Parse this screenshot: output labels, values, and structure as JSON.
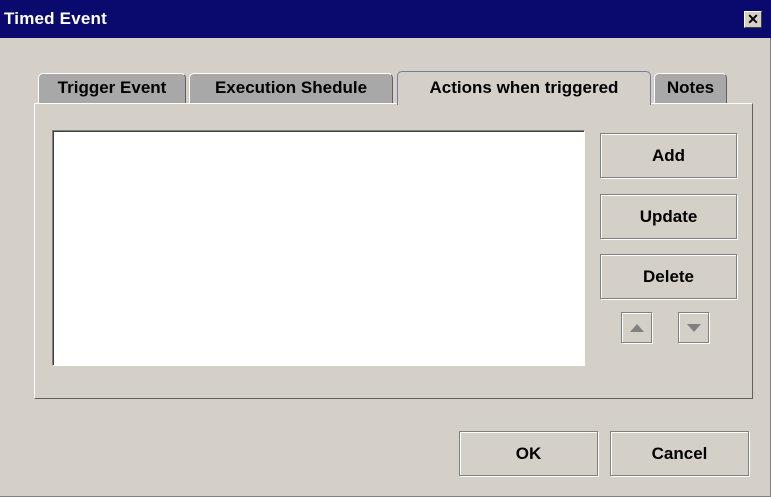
{
  "window": {
    "title": "Timed Event",
    "close_glyph": "✕"
  },
  "tabs": [
    {
      "label": "Trigger Event",
      "active": false
    },
    {
      "label": "Execution Shedule",
      "active": false
    },
    {
      "label": "Actions when triggered",
      "active": true
    },
    {
      "label": "Notes",
      "active": false
    }
  ],
  "actions_panel": {
    "items": [],
    "add_label": "Add",
    "update_label": "Update",
    "delete_label": "Delete",
    "move_up_icon": "triangle-up-icon",
    "move_down_icon": "triangle-down-icon"
  },
  "footer": {
    "ok_label": "OK",
    "cancel_label": "Cancel"
  },
  "colors": {
    "titlebar": "#0a0a6e",
    "face": "#d4d0c8",
    "inactive_tab": "#a8a8a8"
  }
}
